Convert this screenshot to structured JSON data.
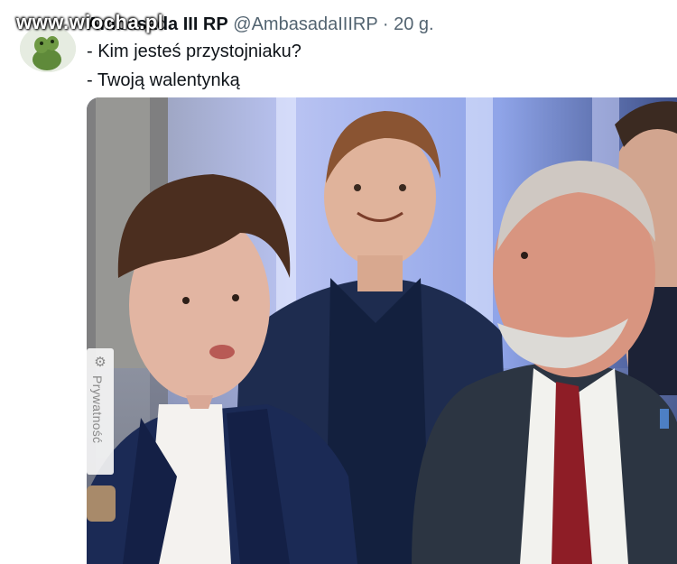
{
  "watermark": "www.wiocha.pl",
  "tweet": {
    "display_name": "Ambasada III RP",
    "handle": "@AmbasadaIIIRP",
    "separator": "·",
    "time": "20 g.",
    "lines": [
      "- Kim jesteś przystojniaku?",
      "- Twoją walentynką"
    ]
  },
  "media": {
    "badge_label": "Prywatność",
    "badge_icon": "gear-icon"
  },
  "colors": {
    "text": "#0f1419",
    "muted": "#536471"
  }
}
